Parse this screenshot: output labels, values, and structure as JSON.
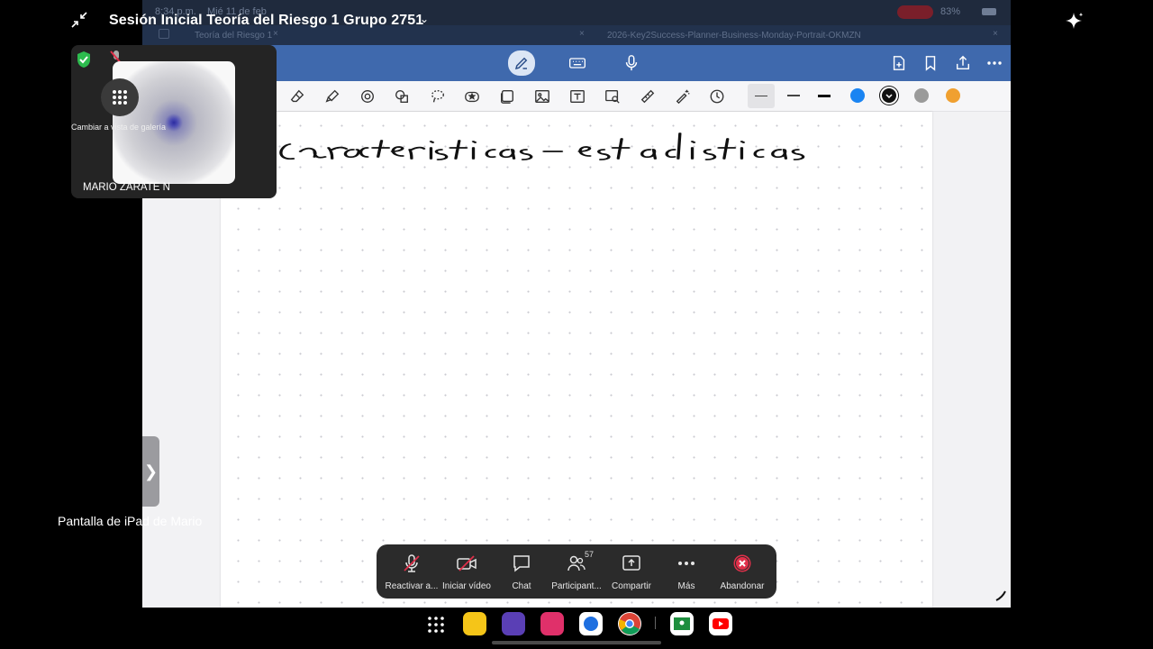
{
  "meeting": {
    "title": "Sesión Inicial Teoría del Riesgo 1 Grupo 2751",
    "participant_name": "MARIO ZÁRATE N",
    "gallery_label": "Cambiar a vista de galería",
    "shared_screen_label": "Pantalla de iPad de Mario",
    "participants_count": "57"
  },
  "ipad": {
    "time": "8:34 p.m.",
    "date": "Mié 11 de feb",
    "battery": "83%",
    "tabs": [
      "Teoría del Riesgo 1",
      "2026-Key2Success-Planner-Business-Monday-Portrait-OKMZN"
    ]
  },
  "note": {
    "handwriting": "Características estadísticas"
  },
  "controls": [
    {
      "label": "Reactivar a...",
      "icon": "microphone-muted-icon"
    },
    {
      "label": "Iniciar vídeo",
      "icon": "video-off-icon"
    },
    {
      "label": "Chat",
      "icon": "chat-icon"
    },
    {
      "label": "Participant...",
      "icon": "participants-icon"
    },
    {
      "label": "Compartir",
      "icon": "share-screen-icon"
    },
    {
      "label": "Más",
      "icon": "more-icon"
    },
    {
      "label": "Abandonar",
      "icon": "leave-icon"
    }
  ],
  "colors": {
    "appbar": "#3f69ad",
    "swatch_blue": "#1a84f2",
    "swatch_black": "#111111",
    "swatch_gray": "#9a9a9a",
    "swatch_orange": "#f0a030",
    "leave_red": "#e0304a"
  }
}
